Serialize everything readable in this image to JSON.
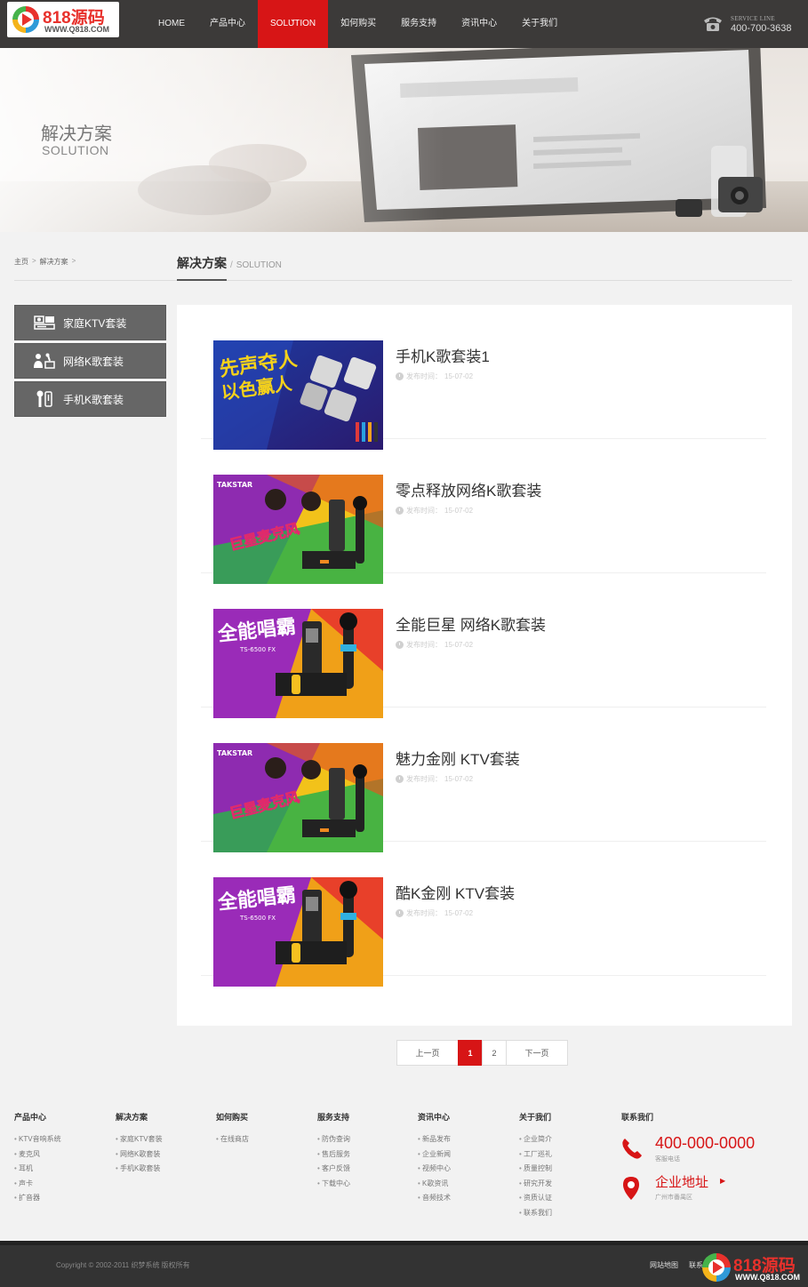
{
  "logo": {
    "main": "818源码",
    "sub": "WWW.Q818.COM"
  },
  "nav": {
    "items": [
      "HOME",
      "产品中心",
      "SOLUTION",
      "如何购买",
      "服务支持",
      "资讯中心",
      "关于我们"
    ],
    "active_index": 2
  },
  "service": {
    "label": "SERVICE LINE",
    "phone": "400-700-3638",
    "icon": "phone-icon"
  },
  "banner": {
    "title": "解决方案",
    "subtitle": "SOLUTION"
  },
  "breadcrumb": {
    "home": "主页",
    "sep": ">",
    "current": "解决方案"
  },
  "section": {
    "title": "解决方案",
    "slash": "/",
    "en": "SOLUTION"
  },
  "sidebar": {
    "items": [
      {
        "label": "家庭KTV套装",
        "icon": "ktv-set-icon"
      },
      {
        "label": "网络K歌套装",
        "icon": "singer-icon"
      },
      {
        "label": "手机K歌套装",
        "icon": "microphone-icon"
      }
    ]
  },
  "list": {
    "date_label": "发布时间：",
    "items": [
      {
        "title": "手机K歌套装1",
        "date": "15-07-02",
        "thumb_text": "先声夺人 以色赢人"
      },
      {
        "title": "零点释放网络K歌套装",
        "date": "15-07-02",
        "thumb_text": "巨星麦克风"
      },
      {
        "title": "全能巨星 网络K歌套装",
        "date": "15-07-02",
        "thumb_text": "全能唱霸"
      },
      {
        "title": "魅力金刚 KTV套装",
        "date": "15-07-02",
        "thumb_text": "巨星麦克风"
      },
      {
        "title": "酷K金刚 KTV套装",
        "date": "15-07-02",
        "thumb_text": "全能唱霸"
      }
    ]
  },
  "pager": {
    "prev": "上一页",
    "pages": [
      "1",
      "2"
    ],
    "current": "1",
    "next": "下一页"
  },
  "footer": {
    "columns": [
      {
        "title": "产品中心",
        "links": [
          "KTV音响系统",
          "麦克风",
          "耳机",
          "声卡",
          "扩音器"
        ]
      },
      {
        "title": "解决方案",
        "links": [
          "家庭KTV套装",
          "网络K歌套装",
          "手机K歌套装"
        ]
      },
      {
        "title": "如何购买",
        "links": [
          "在线商店"
        ]
      },
      {
        "title": "服务支持",
        "links": [
          "防伪查询",
          "售后服务",
          "客户反馈",
          "下载中心"
        ]
      },
      {
        "title": "资讯中心",
        "links": [
          "新品发布",
          "企业新闻",
          "视频中心",
          "K歌资讯",
          "音频技术"
        ]
      },
      {
        "title": "关于我们",
        "links": [
          "企业简介",
          "工厂巡礼",
          "质量控制",
          "研究开发",
          "资质认证",
          "联系我们"
        ]
      }
    ],
    "contact": {
      "title": "联系我们",
      "phone": "400-000-0000",
      "phone_sub": "客服电话",
      "address": "企业地址",
      "address_sub": "广州市番禺区"
    }
  },
  "bottom": {
    "copyright": "Copyright © 2002-2011 织梦系统 版权所有",
    "links": [
      "网站地图",
      "联系我们"
    ]
  },
  "watermark": {
    "main": "818源码",
    "sub": "WWW.Q818.COM"
  },
  "colors": {
    "accent": "#d71516",
    "header": "#3c3a39",
    "sidebar": "#666666"
  }
}
